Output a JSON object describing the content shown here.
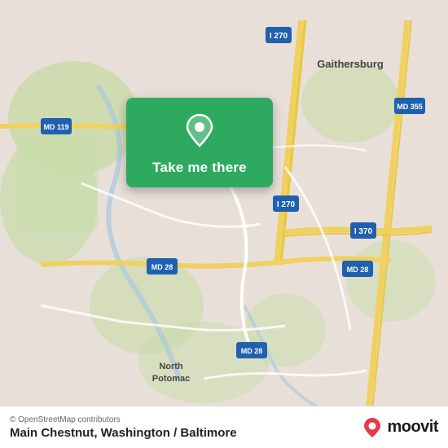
{
  "map": {
    "attribution": "© OpenStreetMap contributors",
    "background_color": "#e8e0d8"
  },
  "card": {
    "button_label": "Take me there",
    "background_color": "#2daa5f"
  },
  "bottom_bar": {
    "attribution": "© OpenStreetMap contributors",
    "location_title": "Main Chestnut, Washington / Baltimore",
    "moovit_label": "moovit"
  }
}
